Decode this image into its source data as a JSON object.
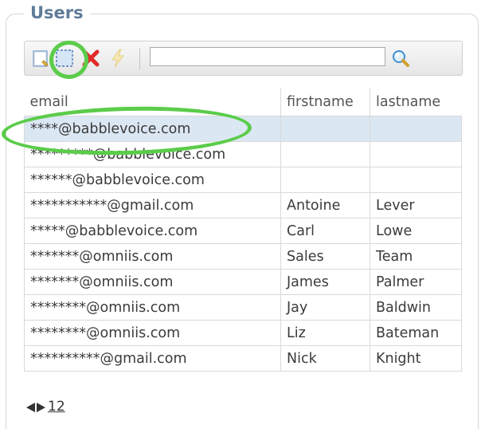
{
  "legend": "Users",
  "toolbar": {
    "search_value": "",
    "buttons": [
      "add-icon",
      "select-icon",
      "delete-icon",
      "lightning-icon"
    ]
  },
  "table": {
    "headers": [
      "email",
      "firstname",
      "lastname"
    ],
    "rows": [
      {
        "email": "****@babblevoice.com",
        "firstname": "",
        "lastname": "",
        "selected": true
      },
      {
        "email": "*********@babblevoice.com",
        "firstname": "",
        "lastname": ""
      },
      {
        "email": "******@babblevoice.com",
        "firstname": "",
        "lastname": ""
      },
      {
        "email": "***********@gmail.com",
        "firstname": "Antoine",
        "lastname": "Lever"
      },
      {
        "email": "*****@babblevoice.com",
        "firstname": "Carl",
        "lastname": "Lowe"
      },
      {
        "email": "*******@omniis.com",
        "firstname": "Sales",
        "lastname": "Team"
      },
      {
        "email": "*******@omniis.com",
        "firstname": "James",
        "lastname": "Palmer"
      },
      {
        "email": "********@omniis.com",
        "firstname": "Jay",
        "lastname": "Baldwin"
      },
      {
        "email": "********@omniis.com",
        "firstname": "Liz",
        "lastname": "Bateman"
      },
      {
        "email": "**********@gmail.com",
        "firstname": "Nick",
        "lastname": "Knight"
      }
    ]
  },
  "pager": {
    "pages": [
      "1",
      "2"
    ]
  },
  "colors": {
    "legend": "#5f7c99",
    "selected_row": "#dbe7f3",
    "highlight": "#5bcc4a"
  }
}
